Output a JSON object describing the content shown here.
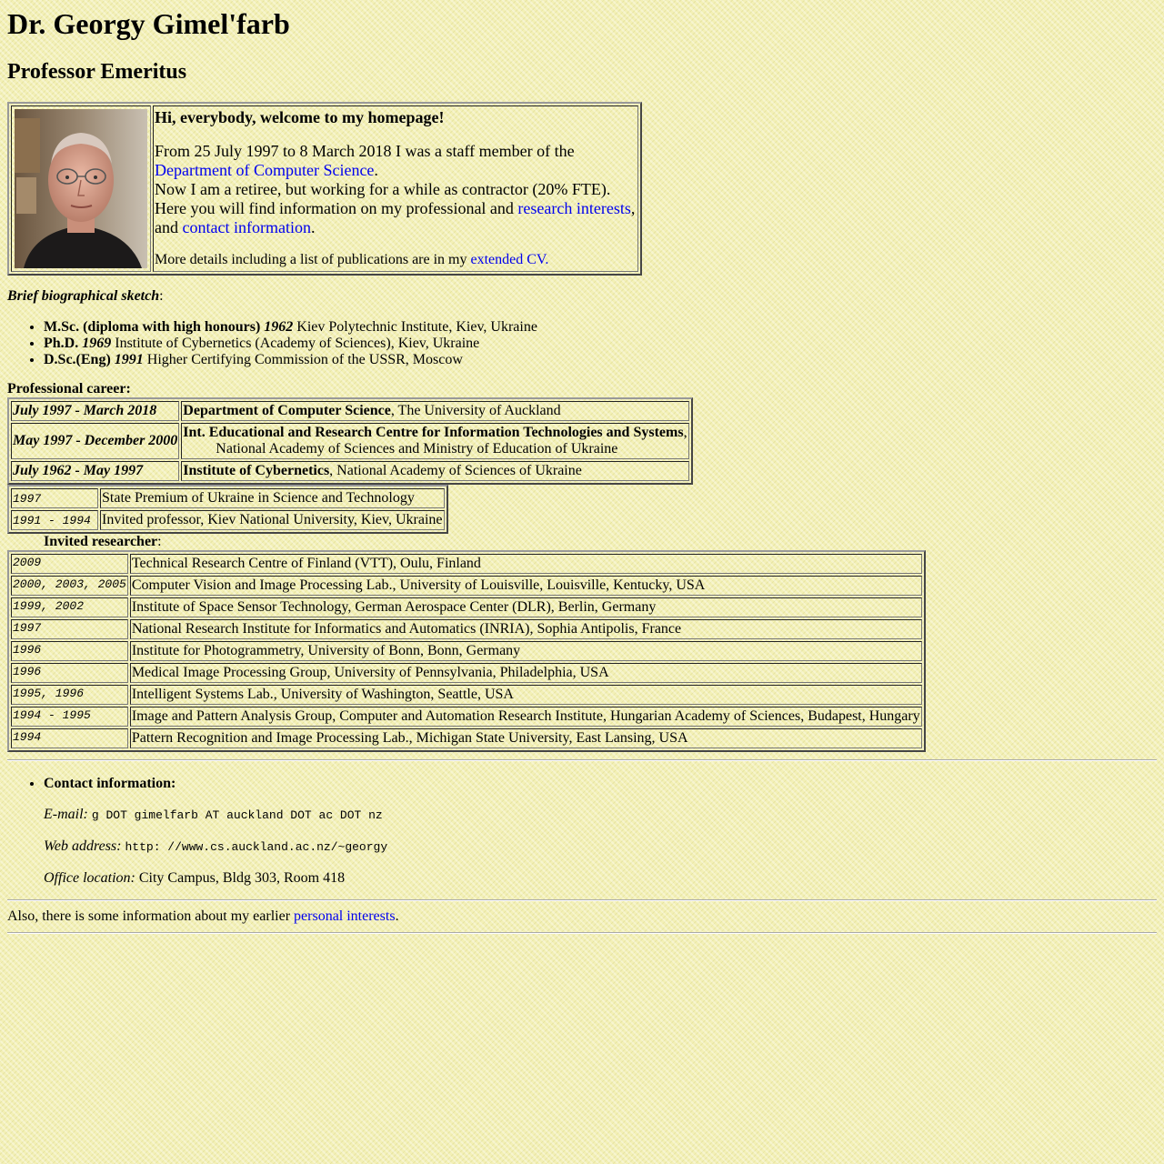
{
  "header": {
    "name": "Dr. Georgy Gimel'farb",
    "title": "Professor Emeritus"
  },
  "intro": {
    "welcome": "Hi, everybody, welcome to my homepage!",
    "line1": "From 25 July 1997 to 8 March 2018 I was a staff member of the",
    "dept_link": "Department of Computer Science",
    "dot": ".",
    "line2": "Now I am a retiree, but working for a while as contractor (20% FTE).",
    "line3a": "Here you will find information on my professional and",
    "research_link": "research interests",
    "comma": ",",
    "and": "and",
    "contact_link": "contact information",
    "more": "More details including a list of publications are in my",
    "cv_link": "extended CV."
  },
  "bio": {
    "title": "Brief biographical sketch",
    "colon": ":",
    "items": [
      {
        "degree": "M.Sc. (diploma with high honours)",
        "year": "1962",
        "place": "Kiev Polytechnic Institute, Kiev, Ukraine"
      },
      {
        "degree": "Ph.D.",
        "year": "1969",
        "place": "Institute of Cybernetics (Academy of Sciences), Kiev, Ukraine"
      },
      {
        "degree": "D.Sc.(Eng)",
        "year": "1991",
        "place": "Higher Certifying Commission of the USSR, Moscow"
      }
    ]
  },
  "career": {
    "title": "Professional career:",
    "rows": [
      {
        "period": "July 1997 - March 2018",
        "org": "Department of Computer Science",
        "detail": ", The University of Auckland",
        "detail2": ""
      },
      {
        "period": "May 1997 - December 2000",
        "org": "Int. Educational and Research Centre for Information Technologies and Systems",
        "detail": ",",
        "detail2": "National Academy of Sciences and Ministry of Education of Ukraine"
      },
      {
        "period": "July 1962 - May 1997",
        "org": "Institute of Cybernetics",
        "detail": ", National Academy of Sciences of Ukraine",
        "detail2": ""
      }
    ]
  },
  "awards": {
    "rows": [
      {
        "year": "1997",
        "text": "State Premium of Ukraine in Science and Technology"
      },
      {
        "year": "1991 - 1994",
        "text": "Invited professor, Kiev National University, Kiev, Ukraine"
      }
    ]
  },
  "invited": {
    "title": "Invited researcher",
    "colon": ":",
    "rows": [
      {
        "year": "2009",
        "text": "Technical Research Centre of Finland (VTT), Oulu, Finland"
      },
      {
        "year": "2000, 2003, 2005",
        "text": "Computer Vision and Image Processing Lab., University of Louisville, Louisville, Kentucky, USA"
      },
      {
        "year": "1999, 2002",
        "text": "Institute of Space Sensor Technology, German Aerospace Center (DLR), Berlin, Germany"
      },
      {
        "year": "1997",
        "text": "National Research Institute for Informatics and Automatics (INRIA), Sophia Antipolis, France"
      },
      {
        "year": "1996",
        "text": "Institute for Photogrammetry, University of Bonn, Bonn, Germany"
      },
      {
        "year": "1996",
        "text": "Medical Image Processing Group, University of Pennsylvania, Philadelphia, USA"
      },
      {
        "year": "1995, 1996",
        "text": "Intelligent Systems Lab., University of Washington, Seattle, USA"
      },
      {
        "year": "1994 - 1995",
        "text": "Image and Pattern Analysis Group, Computer and Automation Research Institute, Hungarian Academy of Sciences, Budapest, Hungary"
      },
      {
        "year": "1994",
        "text": "Pattern Recognition and Image Processing Lab., Michigan State University, East Lansing, USA"
      }
    ]
  },
  "contact": {
    "title": "Contact information:",
    "email_label": "E-mail:",
    "email_value": "g DOT gimelfarb AT auckland DOT ac DOT nz",
    "web_label": "Web address:",
    "web_value": "http: //www.cs.auckland.ac.nz/~georgy",
    "office_label": "Office location:",
    "office_value": "City Campus, Bldg 303, Room 418"
  },
  "footer": {
    "text": "Also, there is some information about my earlier",
    "link": "personal interests",
    "dot": "."
  }
}
